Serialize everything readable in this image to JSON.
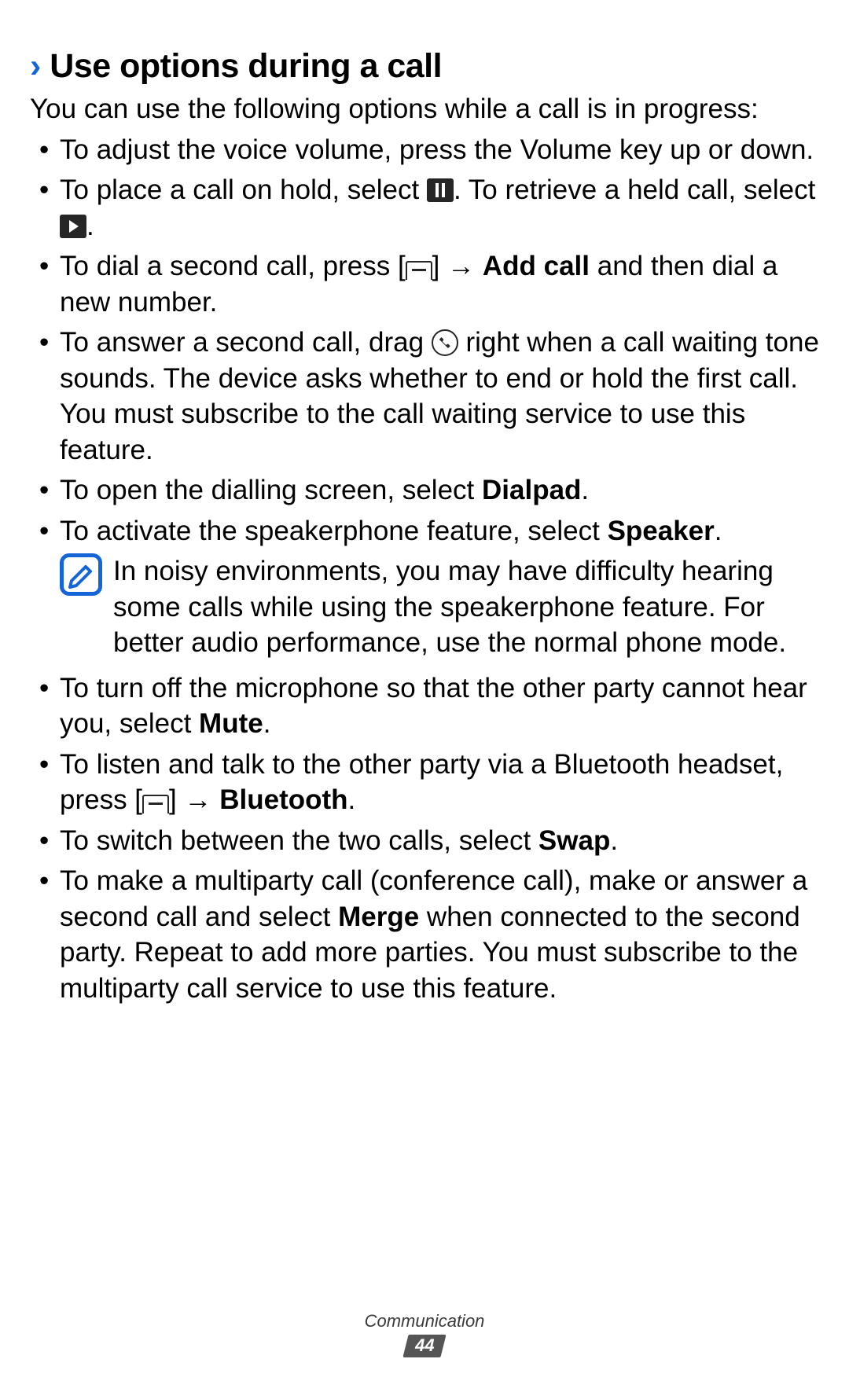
{
  "heading_marker": "›",
  "heading": "Use options during a call",
  "intro": "You can use the following options while a call is in progress:",
  "li1": "To adjust the voice volume, press the Volume key up or down.",
  "li2a": "To place a call on hold, select ",
  "li2b": ". To retrieve a held call, select ",
  "li2c": ".",
  "li3a": "To dial a second call, press [",
  "li3b": "] → ",
  "li3bold": "Add call",
  "li3c": " and then dial a new number.",
  "li4a": "To answer a second call, drag ",
  "li4b": " right when a call waiting tone sounds. The device asks whether to end or hold the first call. You must subscribe to the call waiting service to use this feature.",
  "li5a": "To open the dialling screen, select ",
  "li5bold": "Dialpad",
  "li5c": ".",
  "li6a": "To activate the speakerphone feature, select ",
  "li6bold": "Speaker",
  "li6c": ".",
  "note": "In noisy environments, you may have difficulty hearing some calls while using the speakerphone feature. For better audio performance, use the normal phone mode.",
  "li7a": "To turn off the microphone so that the other party cannot hear you, select ",
  "li7bold": "Mute",
  "li7c": ".",
  "li8a": "To listen and talk to the other party via a Bluetooth headset, press [",
  "li8b": "] → ",
  "li8bold": "Bluetooth",
  "li8c": ".",
  "li9a": "To switch between the two calls, select ",
  "li9bold": "Swap",
  "li9c": ".",
  "li10a": "To make a multiparty call (conference call), make or answer a second call and select ",
  "li10bold": "Merge",
  "li10b": " when connected to the second party. Repeat to add more parties. You must subscribe to the multiparty call service to use this feature.",
  "footer_section": "Communication",
  "footer_page": "44"
}
